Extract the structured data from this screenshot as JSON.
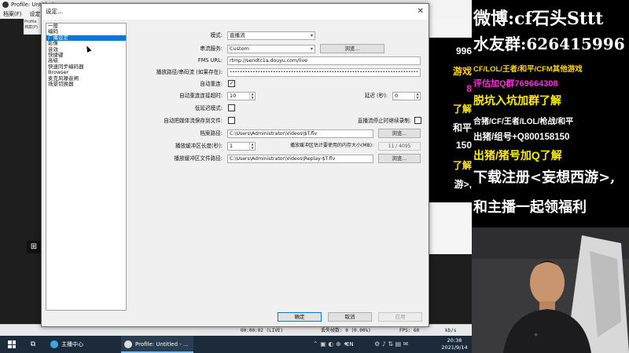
{
  "background_window": {
    "title": "Profile: Untitled - ...",
    "menu": [
      "档案(F)",
      "设定(S)"
    ],
    "left_panel_text": [
      "Profile",
      "档案(P)"
    ],
    "status_time": "00:00:02 (LIVE)",
    "status_dropped": "丢失帧数: 0 (0.00%)",
    "status_fps": "FPS: 60",
    "status_kbps": "kb/s"
  },
  "dialog": {
    "title": "设定...",
    "close_glyph": "✕",
    "categories": [
      "一般",
      "编码",
      "广播设定",
      "影像",
      "音效",
      "快捷键",
      "高级",
      "快速同步编码器",
      "Browser",
      "麦克风噪音闸",
      "场景切换器"
    ],
    "selected_category": "广播设定",
    "fields": {
      "mode_label": "模式:",
      "mode_value": "直播流",
      "service_label": "串流服务:",
      "service_value": "Custom",
      "browse_button": "浏览...",
      "fms_label": "FMS URL:",
      "fms_value": "rtmp://sendtc1a.douyu.com/live",
      "playpath_label": "播放路径/串码流 (如果存在):",
      "playpath_value": "••••••••••••••••••••••••••••••••••••••••••••••••••••••••••••••••••••••••••",
      "auto_reconnect_label": "自动重连:",
      "auto_reconnect_checked": true,
      "reconnect_timeout_label": "自动重连连接超时:",
      "reconnect_timeout_value": "10",
      "delay_label": "延迟 (秒):",
      "delay_value": "0",
      "low_latency_label": "低延迟模式:",
      "auto_save_label": "自动把媒体流保存到文件:",
      "keep_recording_label": "直播流停止时继续录制:",
      "file_path_label": "档案路径:",
      "file_path_value": "C:\\Users\\Administrator\\Videos\\$T.flv",
      "browse_button_2": "浏览...",
      "replay_length_label": "播放缓冲区长度(秒):",
      "replay_length_value": "1",
      "replay_mem_label": "播放缓冲区估计要使用的内存大小(MB):",
      "replay_mem_value": "11 / 4095",
      "replay_path_label": "播放缓冲区文件路径:",
      "replay_path_value": "C:\\Users\\Administrator\\Videos\\Replay-$T.flv",
      "browse_button_3": "浏览..."
    },
    "buttons": {
      "ok": "确定",
      "cancel": "取消",
      "apply": "应用"
    }
  },
  "taskbar": {
    "apps": [
      "主播中心",
      "Profile: Untitled - ..."
    ],
    "ime": "EN",
    "clock_time": "20:38",
    "clock_date": "2021/9/14"
  },
  "promo": {
    "lines": [
      {
        "text": "微博:cf石头Sttt",
        "color": "#ffffff"
      },
      {
        "text": "水友群:626415996",
        "color": "#ffffff"
      },
      {
        "text": "CF/LOL/王者/和平/CFM其他游戏",
        "color": "#ffd400"
      },
      {
        "text": "评估加Q群769664308",
        "color": "#ff2bd6"
      },
      {
        "text": "脱坑入坑加群了解",
        "color": "#ffee00"
      },
      {
        "text": "合猪/CF/王者/LOL/枪战/和平",
        "color": "#ffffff"
      },
      {
        "text": "出猪/组号+Q800158150",
        "color": "#ffffff"
      },
      {
        "text": "出猪/猪号加Q了解",
        "color": "#ffee00"
      },
      {
        "text": "下载注册<妄想西游>,",
        "color": "#ffffff"
      },
      {
        "text": "和主播一起领福利",
        "color": "#ffffff"
      }
    ],
    "strip": [
      "996",
      "游戏",
      "8",
      "了解",
      "和平",
      "150",
      "了解",
      "游>,"
    ]
  },
  "colors": {
    "selection_blue": "#0078d7",
    "taskbar_bg": "#1b2b3a",
    "promo_bg": "#000000"
  }
}
